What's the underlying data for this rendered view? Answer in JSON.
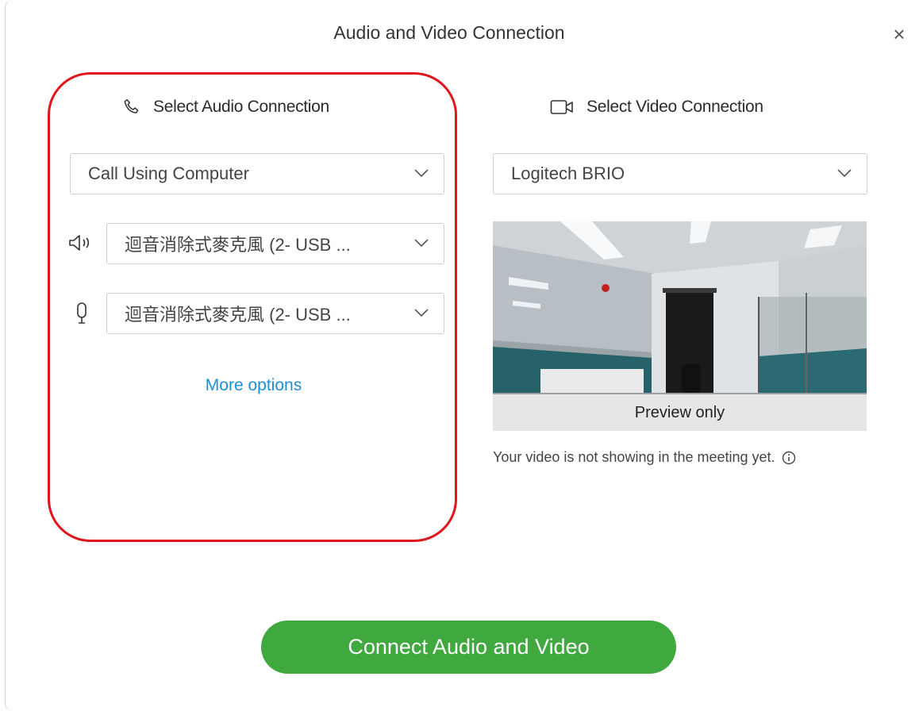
{
  "dialog": {
    "title": "Audio and Video Connection",
    "close_glyph": "×"
  },
  "audio": {
    "heading": "Select Audio Connection",
    "heading_icon": "phone-icon",
    "connection_select": "Call Using Computer",
    "speaker_icon": "speaker-icon",
    "speaker_select": "迴音消除式麥克風 (2- USB ...",
    "microphone_icon": "microphone-icon",
    "microphone_select": "迴音消除式麥克風 (2- USB ...",
    "more_options": "More options"
  },
  "video": {
    "heading": "Select Video Connection",
    "heading_icon": "video-camera-icon",
    "camera_select": "Logitech BRIO",
    "preview_label": "Preview only",
    "notice": "Your video is not showing in the meeting yet.",
    "notice_icon": "info-icon"
  },
  "footer": {
    "connect_button": "Connect Audio and Video"
  },
  "colors": {
    "accent_link": "#1d8fd8",
    "connect_green": "#3fa93f",
    "highlight_red": "#e0161d"
  }
}
